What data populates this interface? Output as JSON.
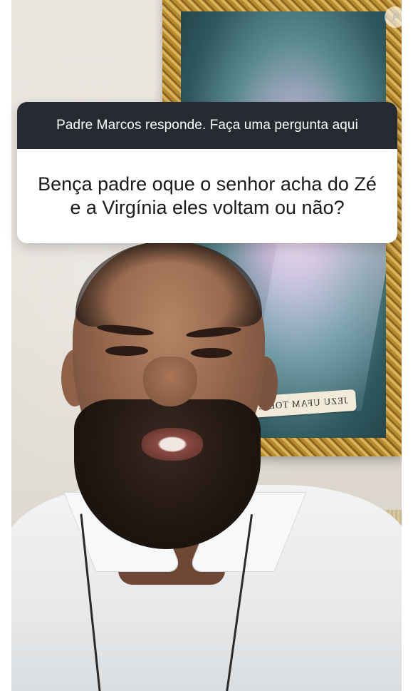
{
  "question_sticker": {
    "header": "Padre Marcos responde. Faça uma pergunta aqui",
    "question": "Bença padre oque o senhor acha do Zé e a Virgínia eles voltam ou não?"
  },
  "background_painting": {
    "banner_text": "JEZU UFAM TOBIE"
  },
  "watermark": {
    "icon": "purepeople-logo-icon",
    "letter": "P"
  }
}
